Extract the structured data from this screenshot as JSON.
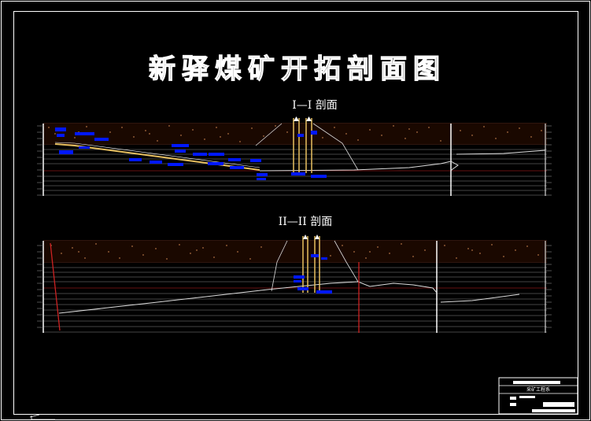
{
  "drawing": {
    "title": "新驿煤矿开拓剖面图",
    "background": "#000000",
    "colors": {
      "frame": "#ffffff",
      "strata": "#b5553a",
      "dots": "#f0a060",
      "coal": "#0018ff",
      "roadway": "#e8c060",
      "seam_line": "#cc2222",
      "surface": "#ffffff"
    }
  },
  "sections": [
    {
      "label": "I—I 剖面"
    },
    {
      "label": "II—II 剖面"
    }
  ],
  "title_block": {
    "heading": "采矿工程系"
  }
}
